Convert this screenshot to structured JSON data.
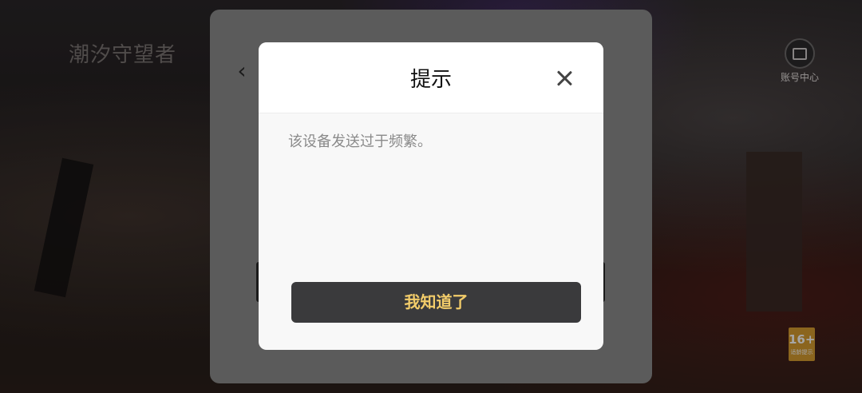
{
  "game": {
    "logo_text": "潮汐守望者"
  },
  "account_center": {
    "label": "账号中心",
    "icon": "account-card-icon"
  },
  "age_rating": {
    "age": "16+",
    "label": "适龄提示"
  },
  "background_panel": {
    "back_icon": "chevron-left-icon",
    "back_glyph": "‹"
  },
  "dialog": {
    "title": "提示",
    "message": "该设备发送过于频繁。",
    "close_icon": "close-icon",
    "confirm_label": "我知道了"
  },
  "colors": {
    "confirm_bg": "#3a3a3c",
    "confirm_text": "#f2cc6a",
    "age_badge": "#d69b2f"
  }
}
